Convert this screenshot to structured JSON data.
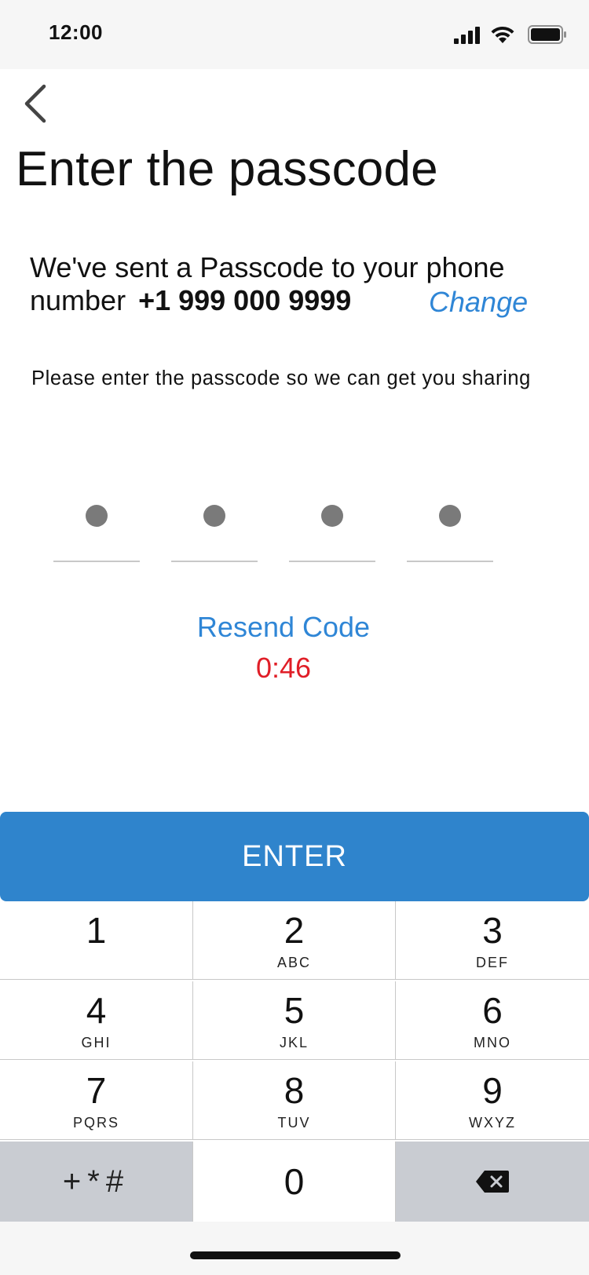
{
  "status_bar": {
    "time": "12:00",
    "icons": [
      "cellular-signal-icon",
      "wifi-icon",
      "battery-icon"
    ]
  },
  "header": {
    "back_icon": "chevron-left-icon",
    "title": "Enter the passcode"
  },
  "message": {
    "line1": "We've sent a Passcode to your phone",
    "line2_prefix": "number",
    "phone_number": "+1 999 000 9999",
    "change_label": "Change"
  },
  "hint": "Please enter the passcode so we can get you sharing",
  "passcode": {
    "filled_count": 4,
    "length": 4
  },
  "resend": {
    "label": "Resend Code",
    "timer": "0:46"
  },
  "enter_button": {
    "label": "ENTER"
  },
  "keypad": {
    "keys": [
      {
        "num": "1",
        "letters": ""
      },
      {
        "num": "2",
        "letters": "ABC"
      },
      {
        "num": "3",
        "letters": "DEF"
      },
      {
        "num": "4",
        "letters": "GHI"
      },
      {
        "num": "5",
        "letters": "JKL"
      },
      {
        "num": "6",
        "letters": "MNO"
      },
      {
        "num": "7",
        "letters": "PQRS"
      },
      {
        "num": "8",
        "letters": "TUV"
      },
      {
        "num": "9",
        "letters": "WXYZ"
      },
      {
        "num": "+*#",
        "letters": ""
      },
      {
        "num": "0",
        "letters": ""
      },
      {
        "num": "",
        "letters": "",
        "icon": "backspace-icon"
      }
    ]
  },
  "colors": {
    "accent_blue": "#2f86d6",
    "button_blue": "#2f84cc",
    "timer_red": "#e01e27",
    "dot_gray": "#7a7a7a",
    "keypad_gray": "#c9ccd2"
  }
}
